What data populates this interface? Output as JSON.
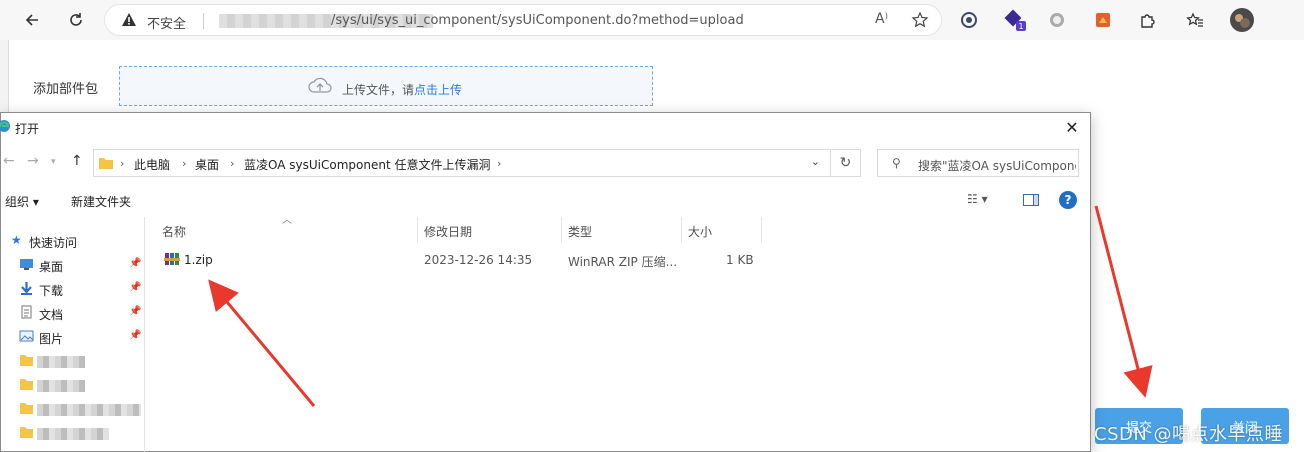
{
  "browser": {
    "insecure_label": "不安全",
    "url_path": "/sys/ui/sys_ui_component/sysUiComponent.do?method=upload",
    "ext_badge": "1"
  },
  "page": {
    "attach_label": "添加部件包",
    "upload_text": "上传文件，请",
    "upload_link": "点击上传",
    "submit_label": "提交",
    "close_label": "关闭"
  },
  "dialog": {
    "title": "打开",
    "breadcrumb": [
      "此电脑",
      "桌面",
      "蓝凌OA sysUiComponent 任意文件上传漏洞"
    ],
    "search_placeholder": "搜索\"蓝凌OA sysUiComponent 任意文件上传漏洞\"",
    "organize_label": "组织 ▾",
    "new_folder_label": "新建文件夹",
    "sidebar": {
      "quick_access": "快速访问",
      "items": [
        {
          "label": "桌面",
          "icon": "desktop-icon"
        },
        {
          "label": "下载",
          "icon": "download-icon"
        },
        {
          "label": "文档",
          "icon": "document-icon"
        },
        {
          "label": "图片",
          "icon": "picture-icon"
        }
      ]
    },
    "columns": [
      "名称",
      "修改日期",
      "类型",
      "大小"
    ],
    "files": [
      {
        "name": "1.zip",
        "modified": "2023-12-26 14:35",
        "type": "WinRAR ZIP 压缩...",
        "size": "1 KB"
      }
    ]
  },
  "watermark": "CSDN @喝点水早点睡",
  "colors": {
    "primary_button": "#4aa1e6",
    "link": "#2b7bd6",
    "annotation_arrow": "#e8392c"
  }
}
